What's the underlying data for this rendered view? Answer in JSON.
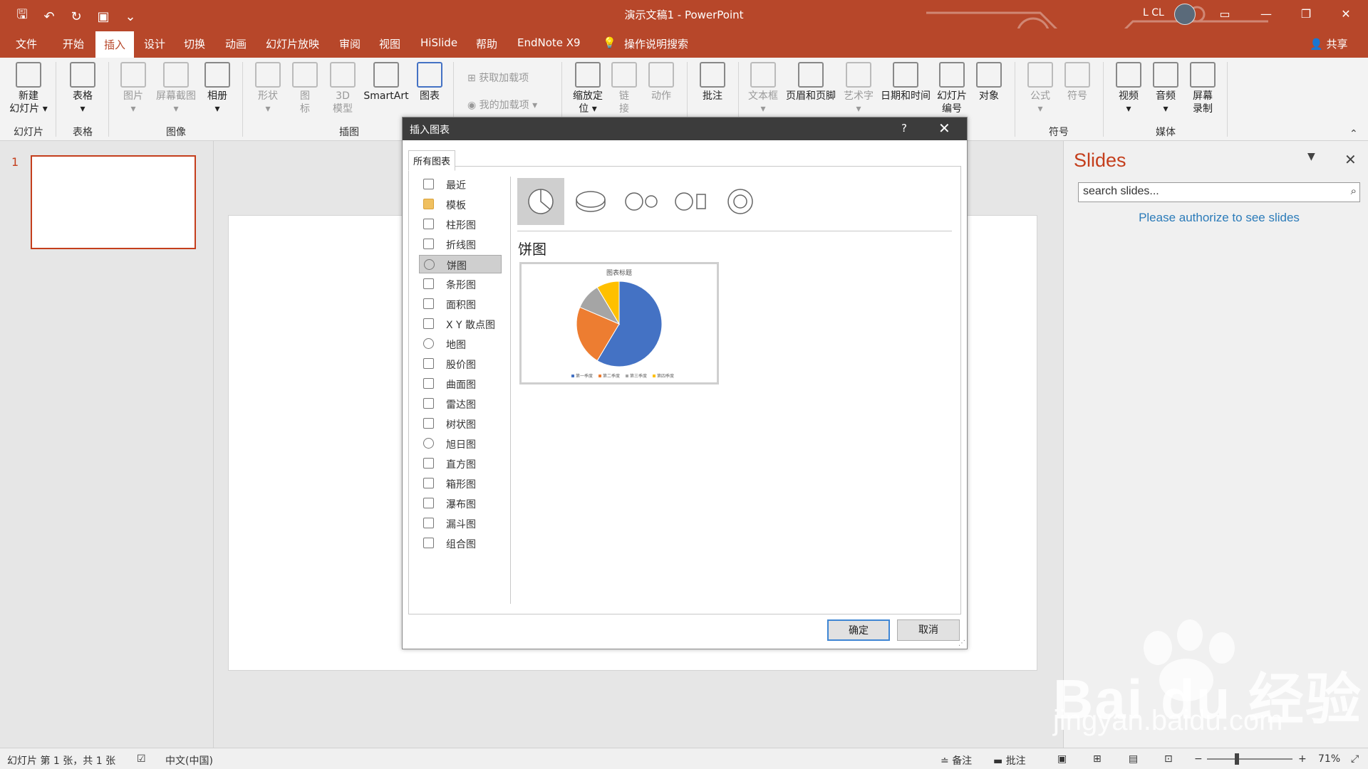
{
  "window": {
    "title": "演示文稿1 - PowerPoint",
    "user": "L CL"
  },
  "tabs": [
    "文件",
    "开始",
    "插入",
    "设计",
    "切换",
    "动画",
    "幻灯片放映",
    "审阅",
    "视图",
    "HiSlide",
    "帮助",
    "EndNote X9",
    "操作说明搜索"
  ],
  "active_tab": "插入",
  "share_label": "共享",
  "ribbon": {
    "buttons": [
      {
        "label": "新建幻灯片",
        "line1": "新建",
        "line2": "幻灯片 ▾",
        "icon": "new-slide-icon"
      },
      {
        "label": "表格",
        "line1": "表格",
        "line2": "▾",
        "icon": "table-icon"
      },
      {
        "label": "图片",
        "line1": "图片",
        "line2": "▾",
        "icon": "picture-icon"
      },
      {
        "label": "屏幕截图",
        "line1": "屏幕截图",
        "line2": "▾",
        "icon": "screenshot-icon"
      },
      {
        "label": "相册",
        "line1": "相册",
        "line2": "▾",
        "icon": "album-icon"
      },
      {
        "label": "形状",
        "line1": "形状",
        "line2": "▾",
        "icon": "shapes-icon"
      },
      {
        "label": "图标",
        "line1": "图",
        "line2": "标",
        "icon": "icons-icon"
      },
      {
        "label": "3D模型",
        "line1": "3D",
        "line2": "模型",
        "icon": "3d-model-icon"
      },
      {
        "label": "SmartArt",
        "line1": "SmartArt",
        "line2": "",
        "icon": "smartart-icon"
      },
      {
        "label": "图表",
        "line1": "图表",
        "line2": "",
        "icon": "chart-icon"
      },
      {
        "label": "获取加载项",
        "line1": "获取加载项",
        "line2": "",
        "icon": "get-addins-icon"
      },
      {
        "label": "我的加载项",
        "line1": "我的加载项 ▾",
        "line2": "",
        "icon": "my-addins-icon"
      },
      {
        "label": "缩放定位",
        "line1": "缩放定",
        "line2": "位 ▾",
        "icon": "zoom-icon"
      },
      {
        "label": "链接",
        "line1": "链",
        "line2": "接",
        "icon": "link-icon"
      },
      {
        "label": "动作",
        "line1": "动作",
        "line2": "",
        "icon": "action-icon"
      },
      {
        "label": "批注",
        "line1": "批注",
        "line2": "",
        "icon": "comment-icon"
      },
      {
        "label": "文本框",
        "line1": "文本框",
        "line2": "▾",
        "icon": "textbox-icon"
      },
      {
        "label": "页眉和页脚",
        "line1": "页眉和页脚",
        "line2": "",
        "icon": "header-footer-icon"
      },
      {
        "label": "艺术字",
        "line1": "艺术字",
        "line2": "▾",
        "icon": "wordart-icon"
      },
      {
        "label": "日期和时间",
        "line1": "日期和时间",
        "line2": "",
        "icon": "date-time-icon"
      },
      {
        "label": "幻灯片编号",
        "line1": "幻灯片",
        "line2": "编号",
        "icon": "slide-number-icon"
      },
      {
        "label": "对象",
        "line1": "对象",
        "line2": "",
        "icon": "object-icon"
      },
      {
        "label": "公式",
        "line1": "公式",
        "line2": "▾",
        "icon": "equation-icon"
      },
      {
        "label": "符号",
        "line1": "符号",
        "line2": "",
        "icon": "symbol-icon"
      },
      {
        "label": "视频",
        "line1": "视频",
        "line2": "▾",
        "icon": "video-icon"
      },
      {
        "label": "音频",
        "line1": "音频",
        "line2": "▾",
        "icon": "audio-icon"
      },
      {
        "label": "屏幕录制",
        "line1": "屏幕",
        "line2": "录制",
        "icon": "screen-record-icon"
      }
    ],
    "groups": [
      "幻灯片",
      "表格",
      "图像",
      "插图",
      "符号",
      "媒体"
    ]
  },
  "slide_panel": {
    "slide_number": "1"
  },
  "dialog": {
    "title": "插入图表",
    "help": "?",
    "tab": "所有图表",
    "categories": [
      "最近",
      "模板",
      "柱形图",
      "折线图",
      "饼图",
      "条形图",
      "面积图",
      "X Y 散点图",
      "地图",
      "股价图",
      "曲面图",
      "雷达图",
      "树状图",
      "旭日图",
      "直方图",
      "箱形图",
      "瀑布图",
      "漏斗图",
      "组合图"
    ],
    "selected_category": "饼图",
    "subtype_title": "饼图",
    "ok": "确定",
    "cancel": "取消"
  },
  "chart_data": {
    "type": "pie",
    "title": "图表标题",
    "categories": [
      "第一季度",
      "第二季度",
      "第三季度",
      "第四季度"
    ],
    "values": [
      8.2,
      3.2,
      1.4,
      1.2
    ],
    "colors": [
      "#4472c4",
      "#ed7d31",
      "#a5a5a5",
      "#ffc000"
    ],
    "legend": "bottom"
  },
  "right_pane": {
    "title": "Slides",
    "search_placeholder": "search slides...",
    "auth_text": "Please authorize to see slides"
  },
  "status_bar": {
    "slide_info": "幻灯片 第 1 张，共 1 张",
    "language": "中文(中国)",
    "notes": "备注",
    "comments": "批注",
    "zoom_minus": "−",
    "zoom_plus": "+",
    "zoom": "71%"
  },
  "watermark": {
    "brand": "Bai du 经验",
    "url": "jingyan.baidu.com"
  },
  "colors": {
    "accent": "#b7472a",
    "slide_outline": "#c43e1c",
    "link": "#2b7bb9"
  }
}
